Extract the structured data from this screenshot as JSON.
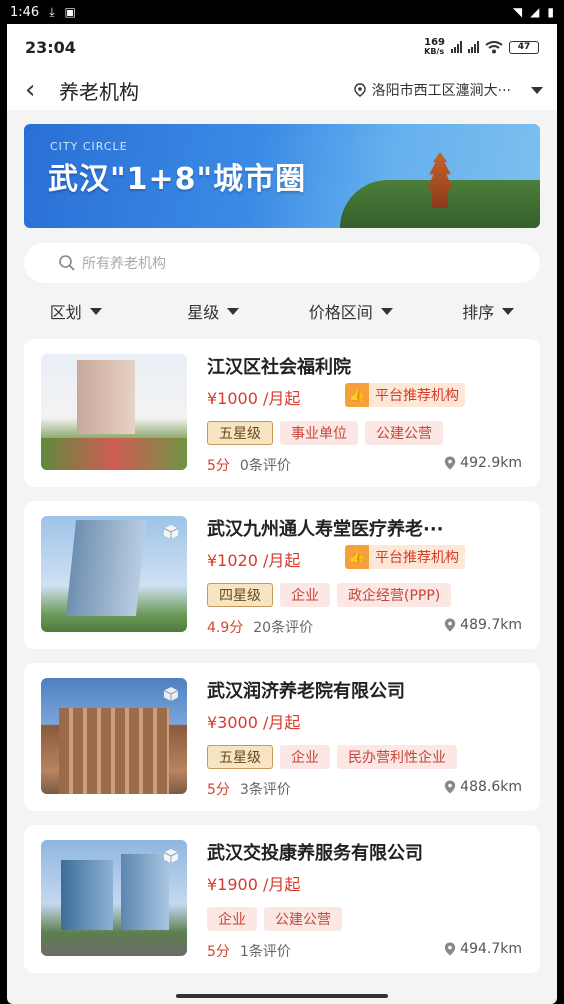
{
  "os_status": {
    "time": "1:46"
  },
  "status": {
    "time": "23:04",
    "speed_value": "169",
    "speed_unit": "KB/s",
    "battery": "47"
  },
  "header": {
    "title": "养老机构",
    "location": "洛阳市西工区瀍涧大···"
  },
  "banner": {
    "subtitle": "CITY CIRCLE",
    "title": "武汉\"1+8\"城市圈"
  },
  "search": {
    "placeholder": "所有养老机构"
  },
  "filters": [
    "区划",
    "星级",
    "价格区间",
    "排序"
  ],
  "colors": {
    "accent_red": "#d83b2e",
    "tag_bg": "#fbe7e4",
    "star_tag_bg": "#f7e4c2",
    "page_bg": "#f4f4f4"
  },
  "listings": [
    {
      "name": "江汉区社会福利院",
      "price": "¥1000 /月起",
      "recommend": "平台推荐机构",
      "tags": [
        "五星级",
        "事业单位",
        "公建公营"
      ],
      "score": "5分",
      "reviews": "0条评价",
      "distance": "492.9km"
    },
    {
      "name": "武汉九州通人寿堂医疗养老···",
      "price": "¥1020 /月起",
      "recommend": "平台推荐机构",
      "tags": [
        "四星级",
        "企业",
        "政企经营(PPP)"
      ],
      "score": "4.9分",
      "reviews": "20条评价",
      "distance": "489.7km"
    },
    {
      "name": "武汉润济养老院有限公司",
      "price": "¥3000 /月起",
      "recommend": "",
      "tags": [
        "五星级",
        "企业",
        "民办营利性企业"
      ],
      "score": "5分",
      "reviews": "3条评价",
      "distance": "488.6km"
    },
    {
      "name": "武汉交投康养服务有限公司",
      "price": "¥1900 /月起",
      "recommend": "",
      "tags": [
        "企业",
        "公建公营"
      ],
      "score": "5分",
      "reviews": "1条评价",
      "distance": "494.7km"
    }
  ]
}
